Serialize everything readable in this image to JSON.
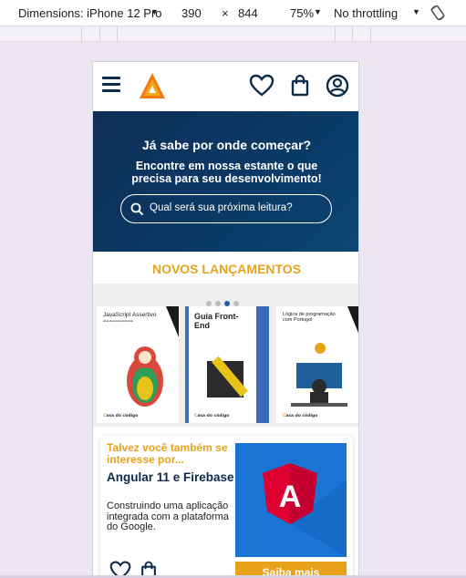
{
  "devtools": {
    "device_label": "Dimensions: iPhone 12 Pro",
    "width": "390",
    "times": "×",
    "height": "844",
    "zoom": "75%",
    "throttling": "No throttling"
  },
  "header": {
    "menu_icon": "hamburger-icon",
    "logo_icon": "orange-triangle-logo",
    "wishlist_icon": "heart-icon",
    "cart_icon": "shopping-bag-icon",
    "account_icon": "user-circle-icon"
  },
  "hero": {
    "title": "Já sabe por onde começar?",
    "subtitle": "Encontre em nossa estante o que precisa para seu desenvolvimento!",
    "search_placeholder": "Qual será sua próxima leitura?"
  },
  "releases": {
    "title": "NOVOS LANÇAMENTOS",
    "active_slide": 3,
    "slide_count": 4,
    "books": [
      {
        "title": "JavaScript Assertivo",
        "publisher": "Casa do Código"
      },
      {
        "title": "Guia Front-End",
        "publisher": "Casa do Código"
      },
      {
        "title": "Lógica de programação com Portugol",
        "publisher": "Casa do Código"
      }
    ]
  },
  "suggestion": {
    "heading": "Talvez você também se interesse por...",
    "book_title": "Angular 11 e Firebase",
    "description": "Construindo uma aplicação integrada com a plataforma do Google.",
    "cta": "Saiba mais",
    "cover_letter": "A"
  },
  "colors": {
    "accent": "#e8a21a",
    "navy": "#0d2b4a",
    "hero_bg": "#0e2e57",
    "dot_active": "#1b5fae"
  }
}
